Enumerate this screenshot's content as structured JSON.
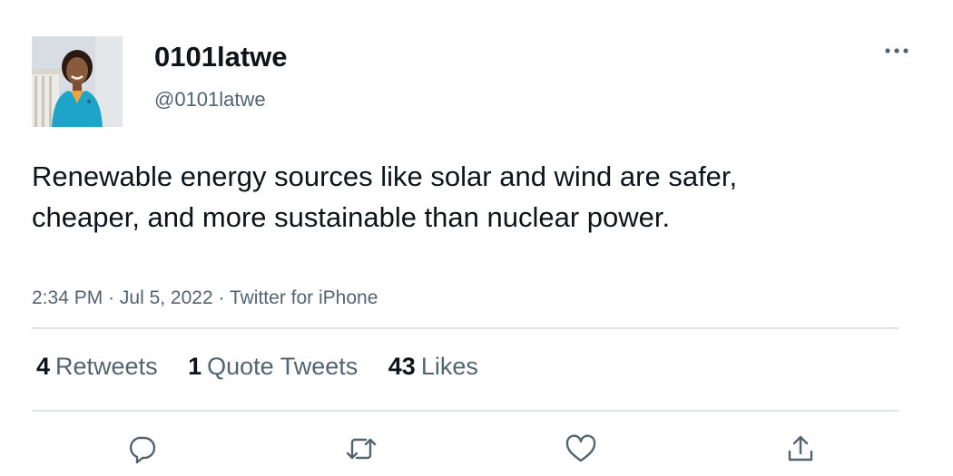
{
  "user": {
    "display_name": "0101latwe",
    "handle": "@0101latwe",
    "avatar_icon": "profile-photo"
  },
  "tweet": {
    "text": "Renewable energy sources like solar and wind are safer, cheaper, and more sustainable than nuclear power.",
    "time": "2:34 PM",
    "date": "Jul 5, 2022",
    "source": "Twitter for iPhone",
    "separator": "·"
  },
  "stats": {
    "retweets": {
      "count": "4",
      "label": "Retweets"
    },
    "quote_tweets": {
      "count": "1",
      "label": "Quote Tweets"
    },
    "likes": {
      "count": "43",
      "label": "Likes"
    }
  },
  "actions": {
    "reply_icon": "reply-icon",
    "retweet_icon": "retweet-icon",
    "like_icon": "heart-icon",
    "share_icon": "share-icon",
    "more_icon": "more-icon"
  },
  "colors": {
    "text_primary": "#0f1419",
    "text_secondary": "#536471",
    "divider": "#dfe3e6"
  }
}
